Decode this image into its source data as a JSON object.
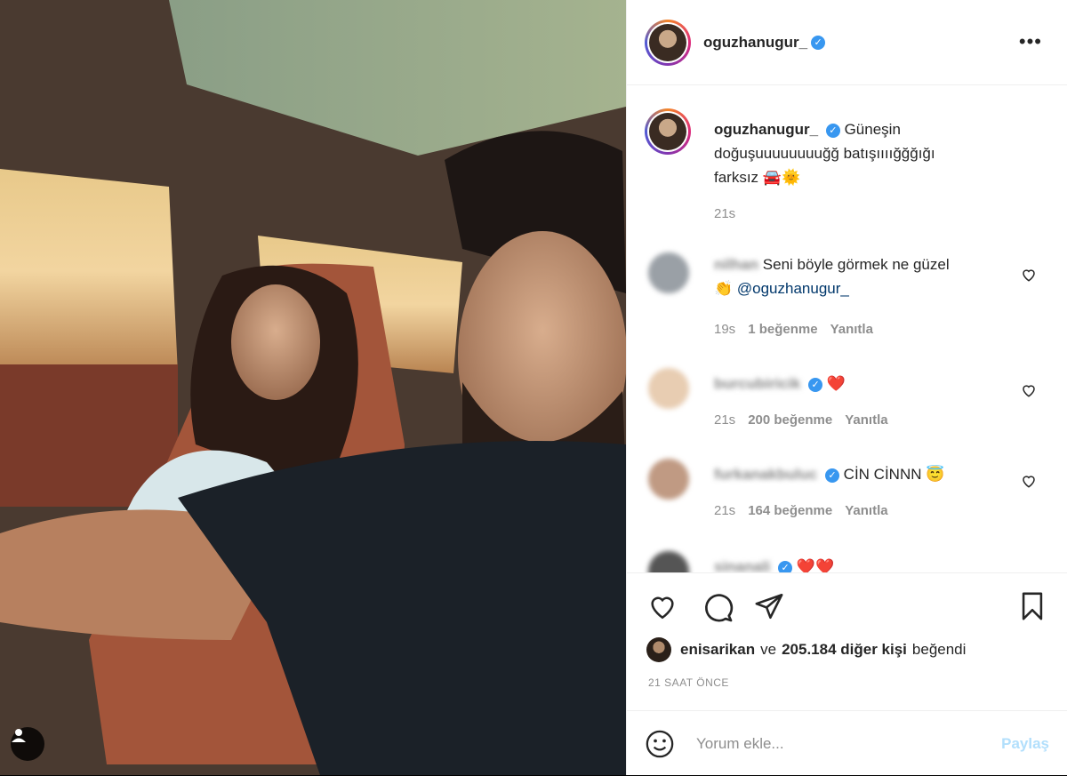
{
  "post": {
    "username": "oguzhanugur_",
    "verified_mark": "✓",
    "more_label": "•••"
  },
  "caption": {
    "username": "oguzhanugur_",
    "text": "Güneşin doğuşuuuuuuuuğğ batışıııığğğığı farksız 🚘🌞",
    "time": "21s"
  },
  "comments": [
    {
      "user": "nilhan",
      "text_pre": "Seni böyle görmek ne güzel 👏 ",
      "mention": "@oguzhanugur_",
      "time": "19s",
      "likes": "1 beğenme",
      "reply": "Yanıtla",
      "verified": false
    },
    {
      "user": "burcubiricik",
      "text_pre": "❤️",
      "mention": "",
      "time": "21s",
      "likes": "200 beğenme",
      "reply": "Yanıtla",
      "verified": true
    },
    {
      "user": "furkanakbuluc",
      "text_pre": "CİN CİNNN 😇",
      "mention": "",
      "time": "21s",
      "likes": "164 beğenme",
      "reply": "Yanıtla",
      "verified": true
    },
    {
      "user": "sinanali",
      "text_pre": "❤️❤️",
      "mention": "",
      "time": "",
      "likes": "",
      "reply": "",
      "verified": true
    }
  ],
  "likes": {
    "user": "enisarikan",
    "connector": "ve",
    "count_text": "205.184 diğer kişi",
    "suffix": "beğendi"
  },
  "timestamp": "21 SAAT ÖNCE",
  "comment_input": {
    "placeholder": "Yorum ekle...",
    "post_label": "Paylaş"
  },
  "icons": {
    "like": "heart-icon",
    "comment": "comment-icon",
    "share": "paper-plane-icon",
    "save": "bookmark-icon",
    "emoji": "smiley-icon",
    "tag": "user-tag-icon"
  },
  "colors": {
    "verified": "#3897f0",
    "mention": "#00376b",
    "post_button": "#b2dffc",
    "muted": "#8e8e8e"
  }
}
